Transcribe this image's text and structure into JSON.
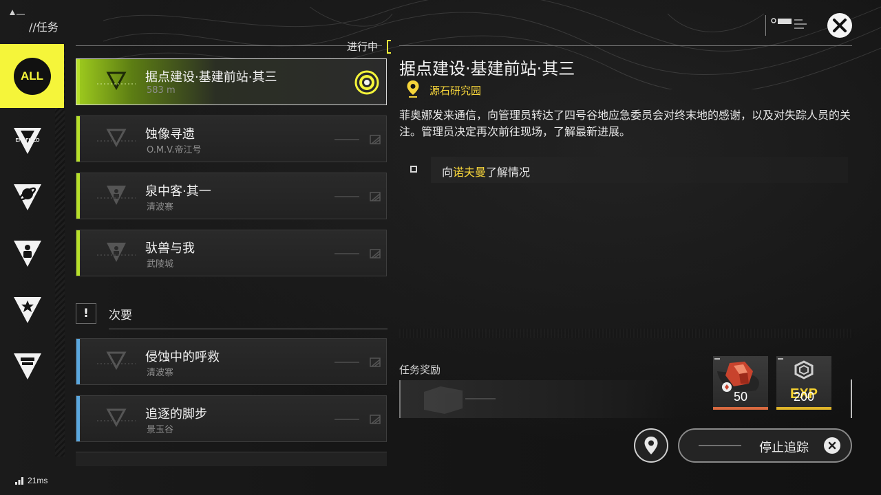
{
  "header": {
    "title": "//任务",
    "status_label": "进行中"
  },
  "sidebar": {
    "items": [
      {
        "label": "ALL",
        "icon": "all-icon",
        "selected": true
      },
      {
        "label": "ENDFIELD",
        "icon": "endfield-icon",
        "selected": false
      },
      {
        "label": "",
        "icon": "orbit-icon",
        "selected": false
      },
      {
        "label": "",
        "icon": "person-icon",
        "selected": false
      },
      {
        "label": "",
        "icon": "star-icon",
        "selected": false
      },
      {
        "label": "",
        "icon": "building-icon",
        "selected": false
      }
    ]
  },
  "quests": {
    "main": [
      {
        "title": "据点建设·基建前站·其三",
        "subtitle": "583 m",
        "active": true
      },
      {
        "title": "蚀像寻遗",
        "subtitle": "O.M.V.帝江号",
        "active": false
      },
      {
        "title": "泉中客·其一",
        "subtitle": "清波寨",
        "active": false
      },
      {
        "title": "驮兽与我",
        "subtitle": "武陵城",
        "active": false
      }
    ],
    "secondary_header": {
      "icon_text": "!",
      "label": "次要"
    },
    "secondary": [
      {
        "title": "侵蚀中的呼救",
        "subtitle": "清波寨"
      },
      {
        "title": "追逐的脚步",
        "subtitle": "景玉谷"
      }
    ]
  },
  "detail": {
    "title": "据点建设·基建前站·其三",
    "location": "源石研究园",
    "description": "菲奥娜发来通信，向管理员转达了四号谷地应急委员会对终末地的感谢，以及对失踪人员的关注。管理员决定再次前往现场，了解最新进展。",
    "objective": {
      "prefix": "向",
      "highlight": "诺夫曼",
      "suffix": "了解情况"
    }
  },
  "rewards": {
    "label": "任务奖励",
    "items": [
      {
        "icon": "crystal-icon",
        "amount": "50"
      },
      {
        "icon": "exp-icon",
        "tag": "EXP",
        "amount": "200"
      }
    ]
  },
  "buttons": {
    "stop_tracking": "停止追踪"
  },
  "network": {
    "ping": "21ms"
  },
  "colors": {
    "accent_yellow": "#f5f53a",
    "main_quest_bar": "#b7e02a",
    "secondary_quest_bar": "#5aa7de",
    "highlight_text": "#f5d43a"
  }
}
